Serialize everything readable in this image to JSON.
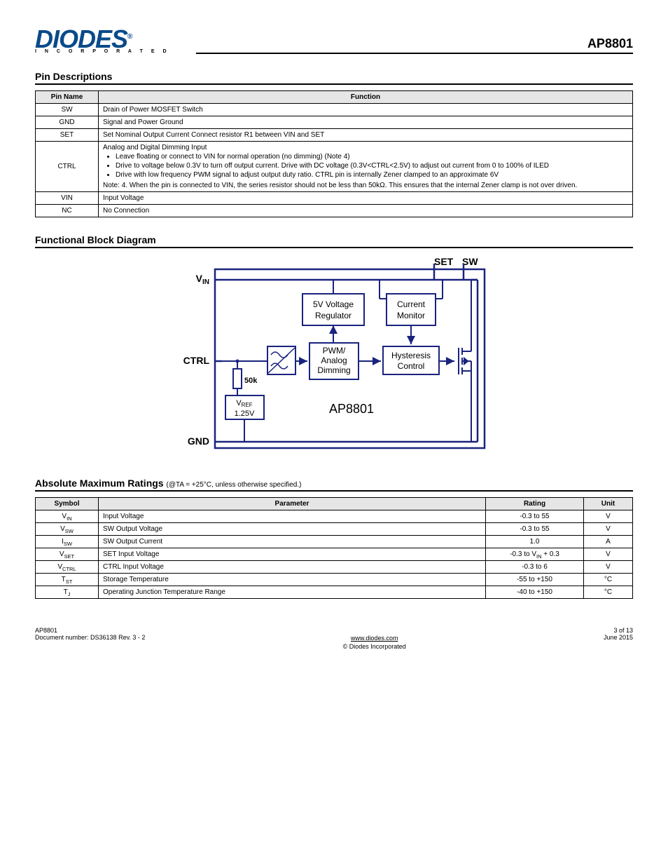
{
  "header": {
    "logo_main": "DIODES",
    "logo_sub": "I N C O R P O R A T E D",
    "partno": "AP8801"
  },
  "pin_table": {
    "title": "Pin Descriptions",
    "head": {
      "name": "Pin Name",
      "func": "Function"
    },
    "rows": [
      {
        "name": "SW",
        "func": "Drain of Power MOSFET Switch"
      },
      {
        "name": "GND",
        "func": "Signal and Power Ground"
      },
      {
        "name": "SET",
        "func": "Set Nominal Output Current Connect resistor R1 between VIN and SET"
      },
      {
        "name": "CTRL",
        "intro": "Analog and Digital Dimming Input",
        "bullets": [
          "Leave floating or connect to VIN for normal operation (no dimming) (Note 4)",
          "Drive to voltage below 0.3V to turn off output current. Drive with DC voltage (0.3V<CTRL<2.5V) to adjust out current from 0 to 100% of ILED",
          "Drive with low frequency PWM signal to adjust output duty ratio. CTRL pin is internally Zener clamped to an approximate 6V"
        ],
        "note_label": "Note:",
        "note_4": "4. When the pin is connected to VIN, the series resistor should not be less than 50kΩ. This ensures that the internal Zener clamp is not over driven."
      },
      {
        "name": "VIN",
        "func": "Input Voltage"
      },
      {
        "name": "NC",
        "func": "No Connection"
      }
    ]
  },
  "block_diagram": {
    "title": "Functional Block Diagram",
    "pins": {
      "vin": "VIN",
      "ctrl": "CTRL",
      "gnd": "GND",
      "set": "SET",
      "sw": "SW"
    },
    "blocks": {
      "reg": "5V Voltage Regulator",
      "mon": "Current Monitor",
      "pwm_l1": "PWM/",
      "pwm_l2": "Analog",
      "pwm_l3": "Dimming",
      "hyst_l1": "Hysteresis",
      "hyst_l2": "Control",
      "r": "50k",
      "vref_l1": "VREF",
      "vref_l2": "1.25V",
      "part": "AP8801"
    }
  },
  "abs_table": {
    "title": "Absolute Maximum Ratings",
    "subtitle": "(@TA = +25°C, unless otherwise specified.)",
    "head": {
      "sym": "Symbol",
      "param": "Parameter",
      "rating": "Rating",
      "unit": "Unit"
    },
    "rows": [
      {
        "sym": "VIN",
        "param": "Input Voltage",
        "rating": "-0.3 to 55",
        "unit": "V"
      },
      {
        "sym": "VSW",
        "param": "SW Output Voltage",
        "rating": "-0.3 to 55",
        "unit": "V"
      },
      {
        "sym": "ISW",
        "param": "SW Output Current",
        "rating": "1.0",
        "unit": "A"
      },
      {
        "sym": "VSET",
        "param": "SET Input Voltage",
        "rating": "-0.3 to VIN + 0.3",
        "unit": "V"
      },
      {
        "sym": "VCTRL",
        "param": "CTRL Input Voltage",
        "rating": "-0.3 to 6",
        "unit": "V"
      },
      {
        "sym": "TST",
        "param": "Storage Temperature",
        "rating": "-55 to +150",
        "unit": "°C"
      },
      {
        "sym": "TJ",
        "param": "Operating Junction Temperature Range",
        "rating": "-40 to +150",
        "unit": "°C"
      }
    ]
  },
  "footer": {
    "left_l1": "AP8801",
    "left_l2": "Document number: DS36138 Rev. 3 - 2",
    "center_l1": "www.diodes.com",
    "right_l1": "3 of 13",
    "right_l2": "June 2015",
    "copyright": "© Diodes Incorporated"
  }
}
